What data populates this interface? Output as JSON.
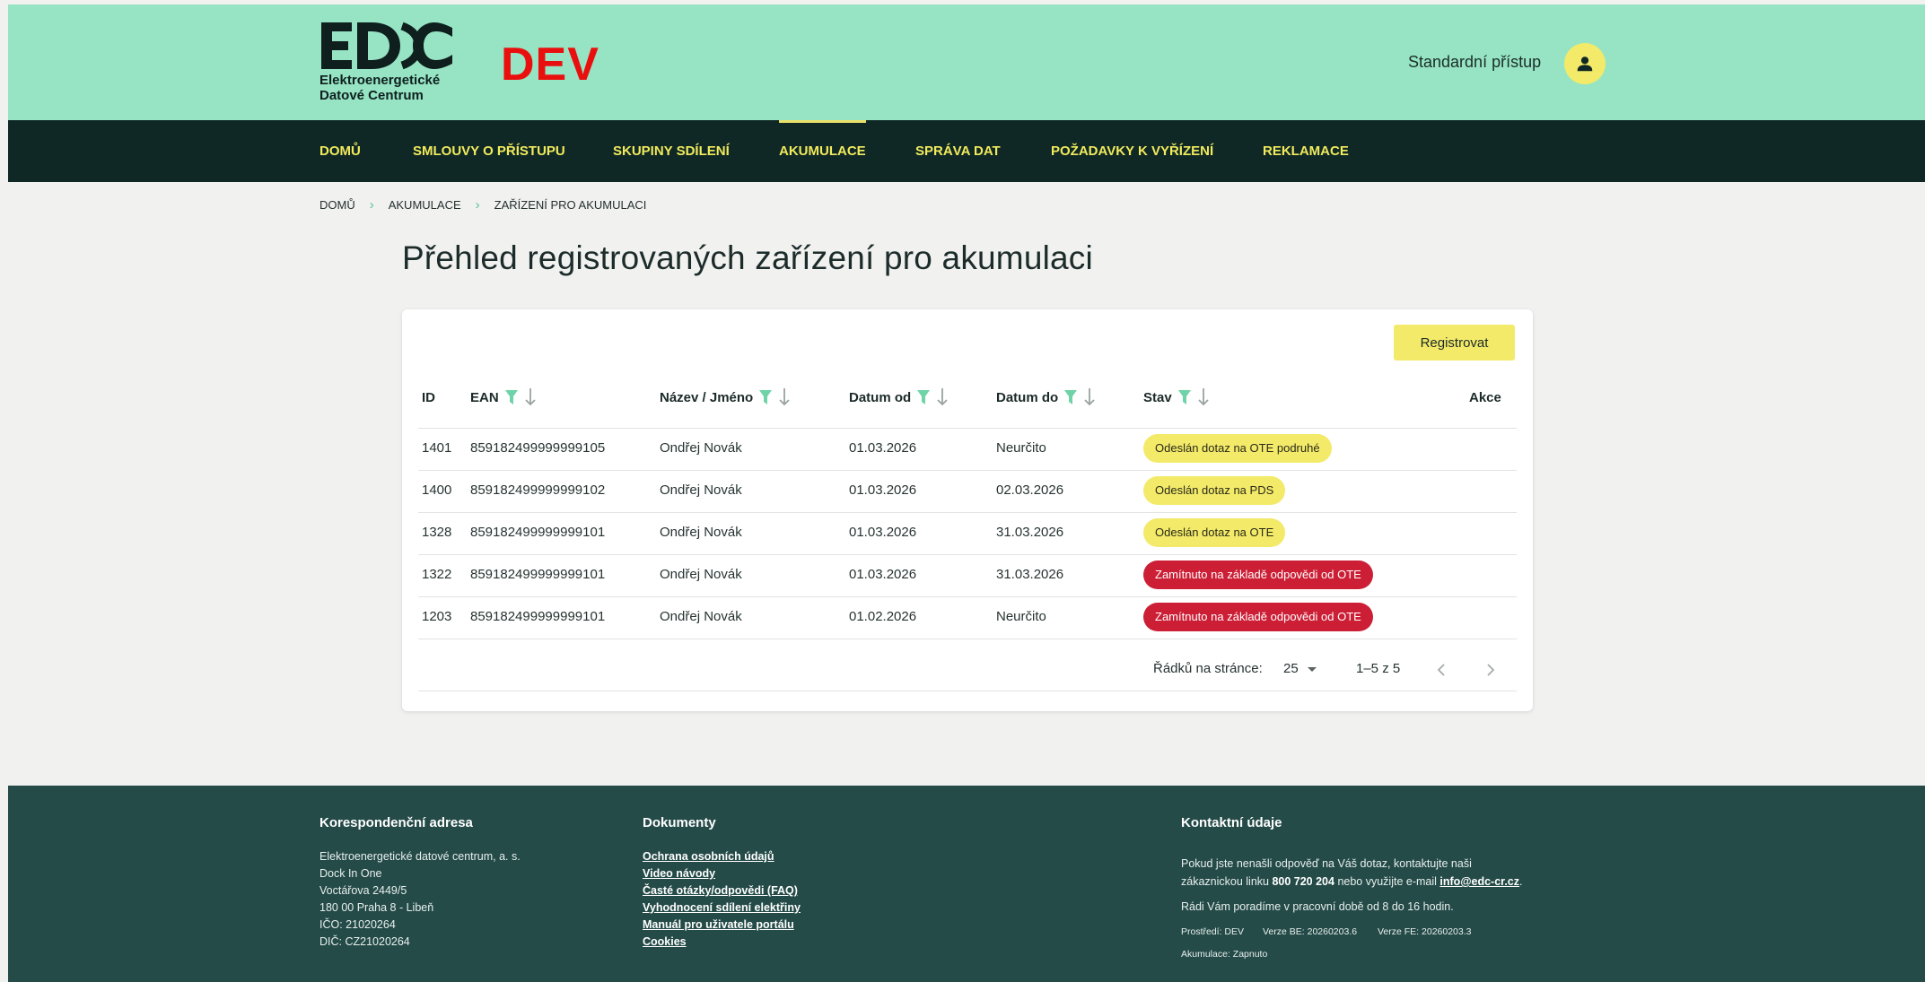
{
  "header": {
    "logo_text_line1": "Elektroenergetické",
    "logo_text_line2": "Datové Centrum",
    "env_label": "DEV",
    "access_label": "Standardní přístup",
    "user_icon": "person-icon"
  },
  "nav": {
    "items": [
      {
        "label": "DOMŮ"
      },
      {
        "label": "SMLOUVY O PŘÍSTUPU"
      },
      {
        "label": "SKUPINY SDÍLENÍ"
      },
      {
        "label": "AKUMULACE"
      },
      {
        "label": "SPRÁVA DAT"
      },
      {
        "label": "POŽADAVKY K VYŘÍZENÍ"
      },
      {
        "label": "REKLAMACE"
      }
    ],
    "active": "AKUMULACE"
  },
  "breadcrumb": [
    "DOMŮ",
    "AKUMULACE",
    "ZAŘÍZENÍ PRO AKUMULACI"
  ],
  "page_title": "Přehled registrovaných zařízení pro akumulaci",
  "register_button": "Registrovat",
  "table": {
    "headers": {
      "id": "ID",
      "ean": "EAN",
      "name": "Název / Jméno",
      "date_from": "Datum od",
      "date_to": "Datum do",
      "state": "Stav",
      "actions": "Akce"
    },
    "rows": [
      {
        "id": "1401",
        "ean": "859182499999999105",
        "name": "Ondřej Novák",
        "date_from": "01.03.2026",
        "date_to": "Neurčito",
        "state": "Odeslán dotaz na OTE podruhé",
        "state_color": "yellow"
      },
      {
        "id": "1400",
        "ean": "859182499999999102",
        "name": "Ondřej Novák",
        "date_from": "01.03.2026",
        "date_to": "02.03.2026",
        "state": "Odeslán dotaz na PDS",
        "state_color": "yellow"
      },
      {
        "id": "1328",
        "ean": "859182499999999101",
        "name": "Ondřej Novák",
        "date_from": "01.03.2026",
        "date_to": "31.03.2026",
        "state": "Odeslán dotaz na OTE",
        "state_color": "yellow"
      },
      {
        "id": "1322",
        "ean": "859182499999999101",
        "name": "Ondřej Novák",
        "date_from": "01.03.2026",
        "date_to": "31.03.2026",
        "state": "Zamítnuto na základě odpovědi od OTE",
        "state_color": "red"
      },
      {
        "id": "1203",
        "ean": "859182499999999101",
        "name": "Ondřej Novák",
        "date_from": "01.02.2026",
        "date_to": "Neurčito",
        "state": "Zamítnuto na základě odpovědi od OTE",
        "state_color": "red"
      }
    ]
  },
  "pagination": {
    "rows_per_page_label": "Řádků na stránce:",
    "rows_per_page": "25",
    "range": "1–5 z 5"
  },
  "footer": {
    "address": {
      "title": "Korespondenční adresa",
      "lines": [
        "Elektroenergetické datové centrum, a. s.",
        "Dock In One",
        "Voctářova 2449/5",
        "180 00 Praha 8 - Libeň",
        "IČO: 21020264",
        "DIČ: CZ21020264"
      ]
    },
    "documents": {
      "title": "Dokumenty",
      "links": [
        "Ochrana osobních údajů",
        "Video návody",
        "Časté otázky/odpovědi (FAQ)",
        "Vyhodnocení sdílení elektřiny",
        "Manuál pro uživatele portálu",
        "Cookies"
      ]
    },
    "contact": {
      "title": "Kontaktní údaje",
      "text_1": "Pokud jste nenašli odpověď na Váš dotaz, kontaktujte naši",
      "text_2_pre": "zákaznickou linku",
      "phone": "800 720 204",
      "text_2_mid": "nebo využijte e-mail",
      "email": "info@edc-cr.cz",
      "text_2_post": ".",
      "hours": "Rádi Vám poradíme v pracovní době od 8 do 16 hodin.",
      "env": "Prostředí: DEV",
      "version_be": "Verze BE: 20260203.6",
      "version_fe": "Verze FE: 20260203.3",
      "accumulation": "Akumulace: Zapnuto"
    }
  },
  "colors": {
    "topbar": "#96e4c3",
    "navbar": "#0f2826",
    "nav_text": "#f1ea5c",
    "badge_yellow": "#f3ea69",
    "badge_red": "#cc1f36",
    "footer": "#244b48",
    "filter_icon": "#6fd3a8"
  }
}
